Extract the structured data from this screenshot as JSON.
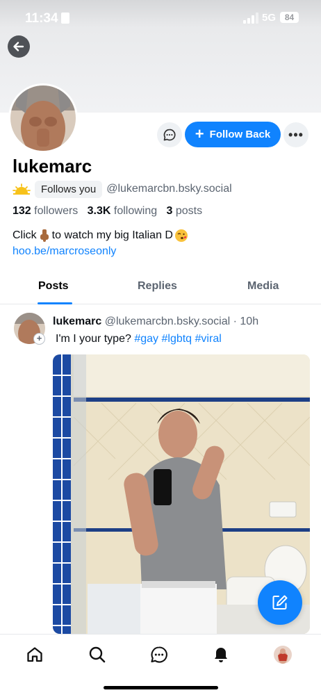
{
  "status_bar": {
    "time": "11:34",
    "network": "5G",
    "battery": "84"
  },
  "profile": {
    "display_name": "lukemarc",
    "follows_you_label": "Follows you",
    "handle": "@lukemarcbn.bsky.social",
    "followers_count": "132",
    "followers_label": "followers",
    "following_count": "3.3K",
    "following_label": "following",
    "posts_count": "3",
    "posts_label": "posts",
    "bio_part1": "Click",
    "bio_part2": "to watch my big Italian D",
    "bio_link": "hoo.be/marcroseonly",
    "follow_button_label": "Follow Back"
  },
  "tabs": [
    {
      "label": "Posts",
      "active": true
    },
    {
      "label": "Replies",
      "active": false
    },
    {
      "label": "Media",
      "active": false
    }
  ],
  "post": {
    "author": "lukemarc",
    "handle": "@lukemarcbn.bsky.social",
    "separator": "·",
    "time": "10h",
    "text": "I'm I your type?",
    "hashtags": [
      "#gay",
      "#lgbtq",
      "#viral"
    ]
  },
  "icons": {
    "back": "arrow-left-icon",
    "message": "chat-bubble-icon",
    "more": "ellipsis-icon",
    "compose": "compose-icon",
    "nav": [
      "home-icon",
      "search-icon",
      "chat-icon",
      "bell-icon",
      "profile-avatar"
    ]
  },
  "colors": {
    "accent": "#1083fe",
    "text": "#0b0f14",
    "muted": "#5b6470"
  }
}
